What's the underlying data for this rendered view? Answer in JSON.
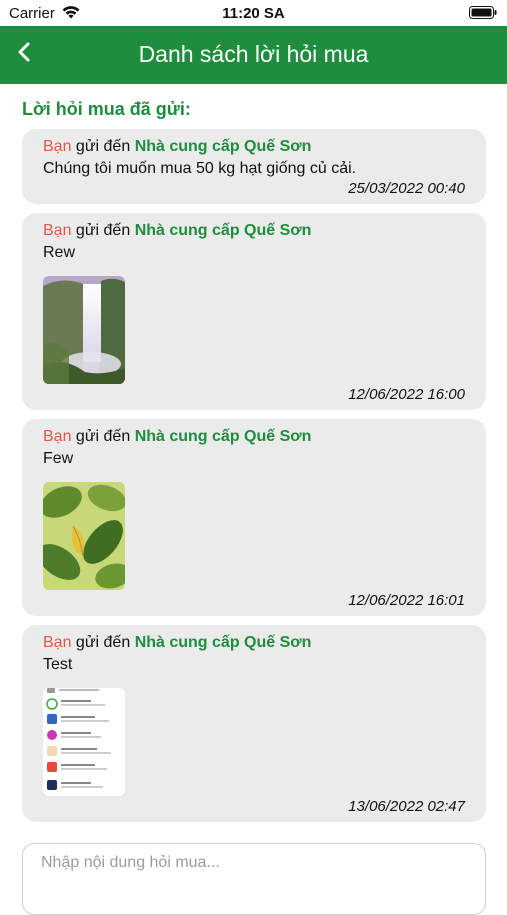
{
  "status_bar": {
    "carrier": "Carrier",
    "time": "11:20 SA"
  },
  "nav": {
    "title": "Danh sách lời hỏi mua",
    "back_icon": "chevron-left-icon"
  },
  "section_title": "Lời hỏi mua đã gửi:",
  "colors": {
    "brand_green": "#1e8e3e",
    "sender_red": "#e4574b",
    "card_bg": "#ebebeb"
  },
  "inquiries": [
    {
      "sender": "Bạn",
      "verb": "gửi đến",
      "supplier": "Nhà cung cấp Quế Sơn",
      "message": "Chúng tôi muốn mua 50 kg hạt giống củ cải.",
      "timestamp": "25/03/2022 00:40"
    },
    {
      "sender": "Bạn",
      "verb": "gửi đến",
      "supplier": "Nhà cung cấp Quế Sơn",
      "message": "Rew",
      "image": "waterfall-photo",
      "timestamp": "12/06/2022 16:00"
    },
    {
      "sender": "Bạn",
      "verb": "gửi đến",
      "supplier": "Nhà cung cấp Quế Sơn",
      "message": "Few",
      "image": "leaf-photo",
      "timestamp": "12/06/2022 16:01"
    },
    {
      "sender": "Bạn",
      "verb": "gửi đến",
      "supplier": "Nhà cung cấp Quế Sơn",
      "message": "Test",
      "image": "app-list-screenshot",
      "timestamp": "13/06/2022 02:47"
    }
  ],
  "composer": {
    "placeholder": "Nhập nội dung hỏi mua..."
  }
}
